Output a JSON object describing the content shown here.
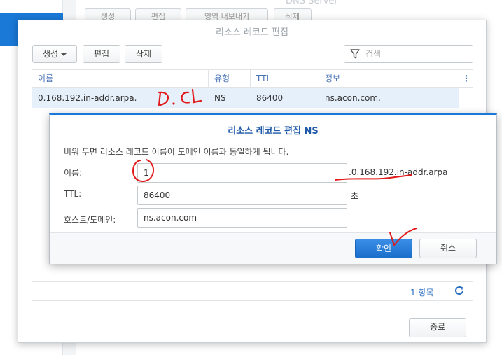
{
  "background": {
    "title": "DNS Server",
    "toolbar": [
      "생성",
      "편집",
      "영역 내보내기",
      "삭제"
    ]
  },
  "window": {
    "title": "리소스 레코드 편집",
    "toolbar": {
      "create_label": "생성",
      "edit_label": "편집",
      "delete_label": "삭제"
    },
    "search": {
      "placeholder": "검색"
    },
    "columns": [
      "이름",
      "유형",
      "TTL",
      "정보"
    ],
    "rows": [
      {
        "name": "0.168.192.in-addr.arpa.",
        "type": "NS",
        "ttl": "86400",
        "info": "ns.acon.com."
      }
    ],
    "count_label": "1 항목",
    "close_label": "종료"
  },
  "dialog": {
    "title": "리소스 레코드 편집 NS",
    "description": "비워 두면 리소스 레코드 이름이 도메인 이름과 동일하게 됩니다.",
    "name_label": "이름:",
    "name_value": "1",
    "name_suffix": ".0.168.192.in-addr.arpa",
    "ttl_label": "TTL:",
    "ttl_value": "86400",
    "ttl_unit": "초",
    "host_label": "호스트/도메인:",
    "host_value": "ns.acon.com",
    "ok_label": "확인",
    "cancel_label": "취소"
  },
  "annotations": {
    "color": "#e11b1b",
    "scribble_text": "D.C"
  }
}
